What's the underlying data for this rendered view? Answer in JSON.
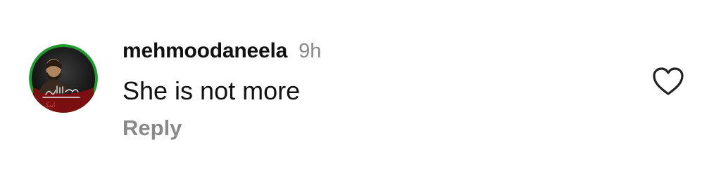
{
  "comment": {
    "username": "mehmoodaneela",
    "time": "9h",
    "text": "She is not more",
    "reply_label": "Reply",
    "avatar_calligraphy": "السلام علیک یا رسول اللہ",
    "like_icon": "heart-outline-icon"
  },
  "colors": {
    "username": "#111111",
    "meta": "#8a8a8a",
    "text": "#111111",
    "avatar_ring_outer": "#1f9a2e",
    "avatar_banner": "#7a0f12",
    "like_icon": "#222222"
  }
}
